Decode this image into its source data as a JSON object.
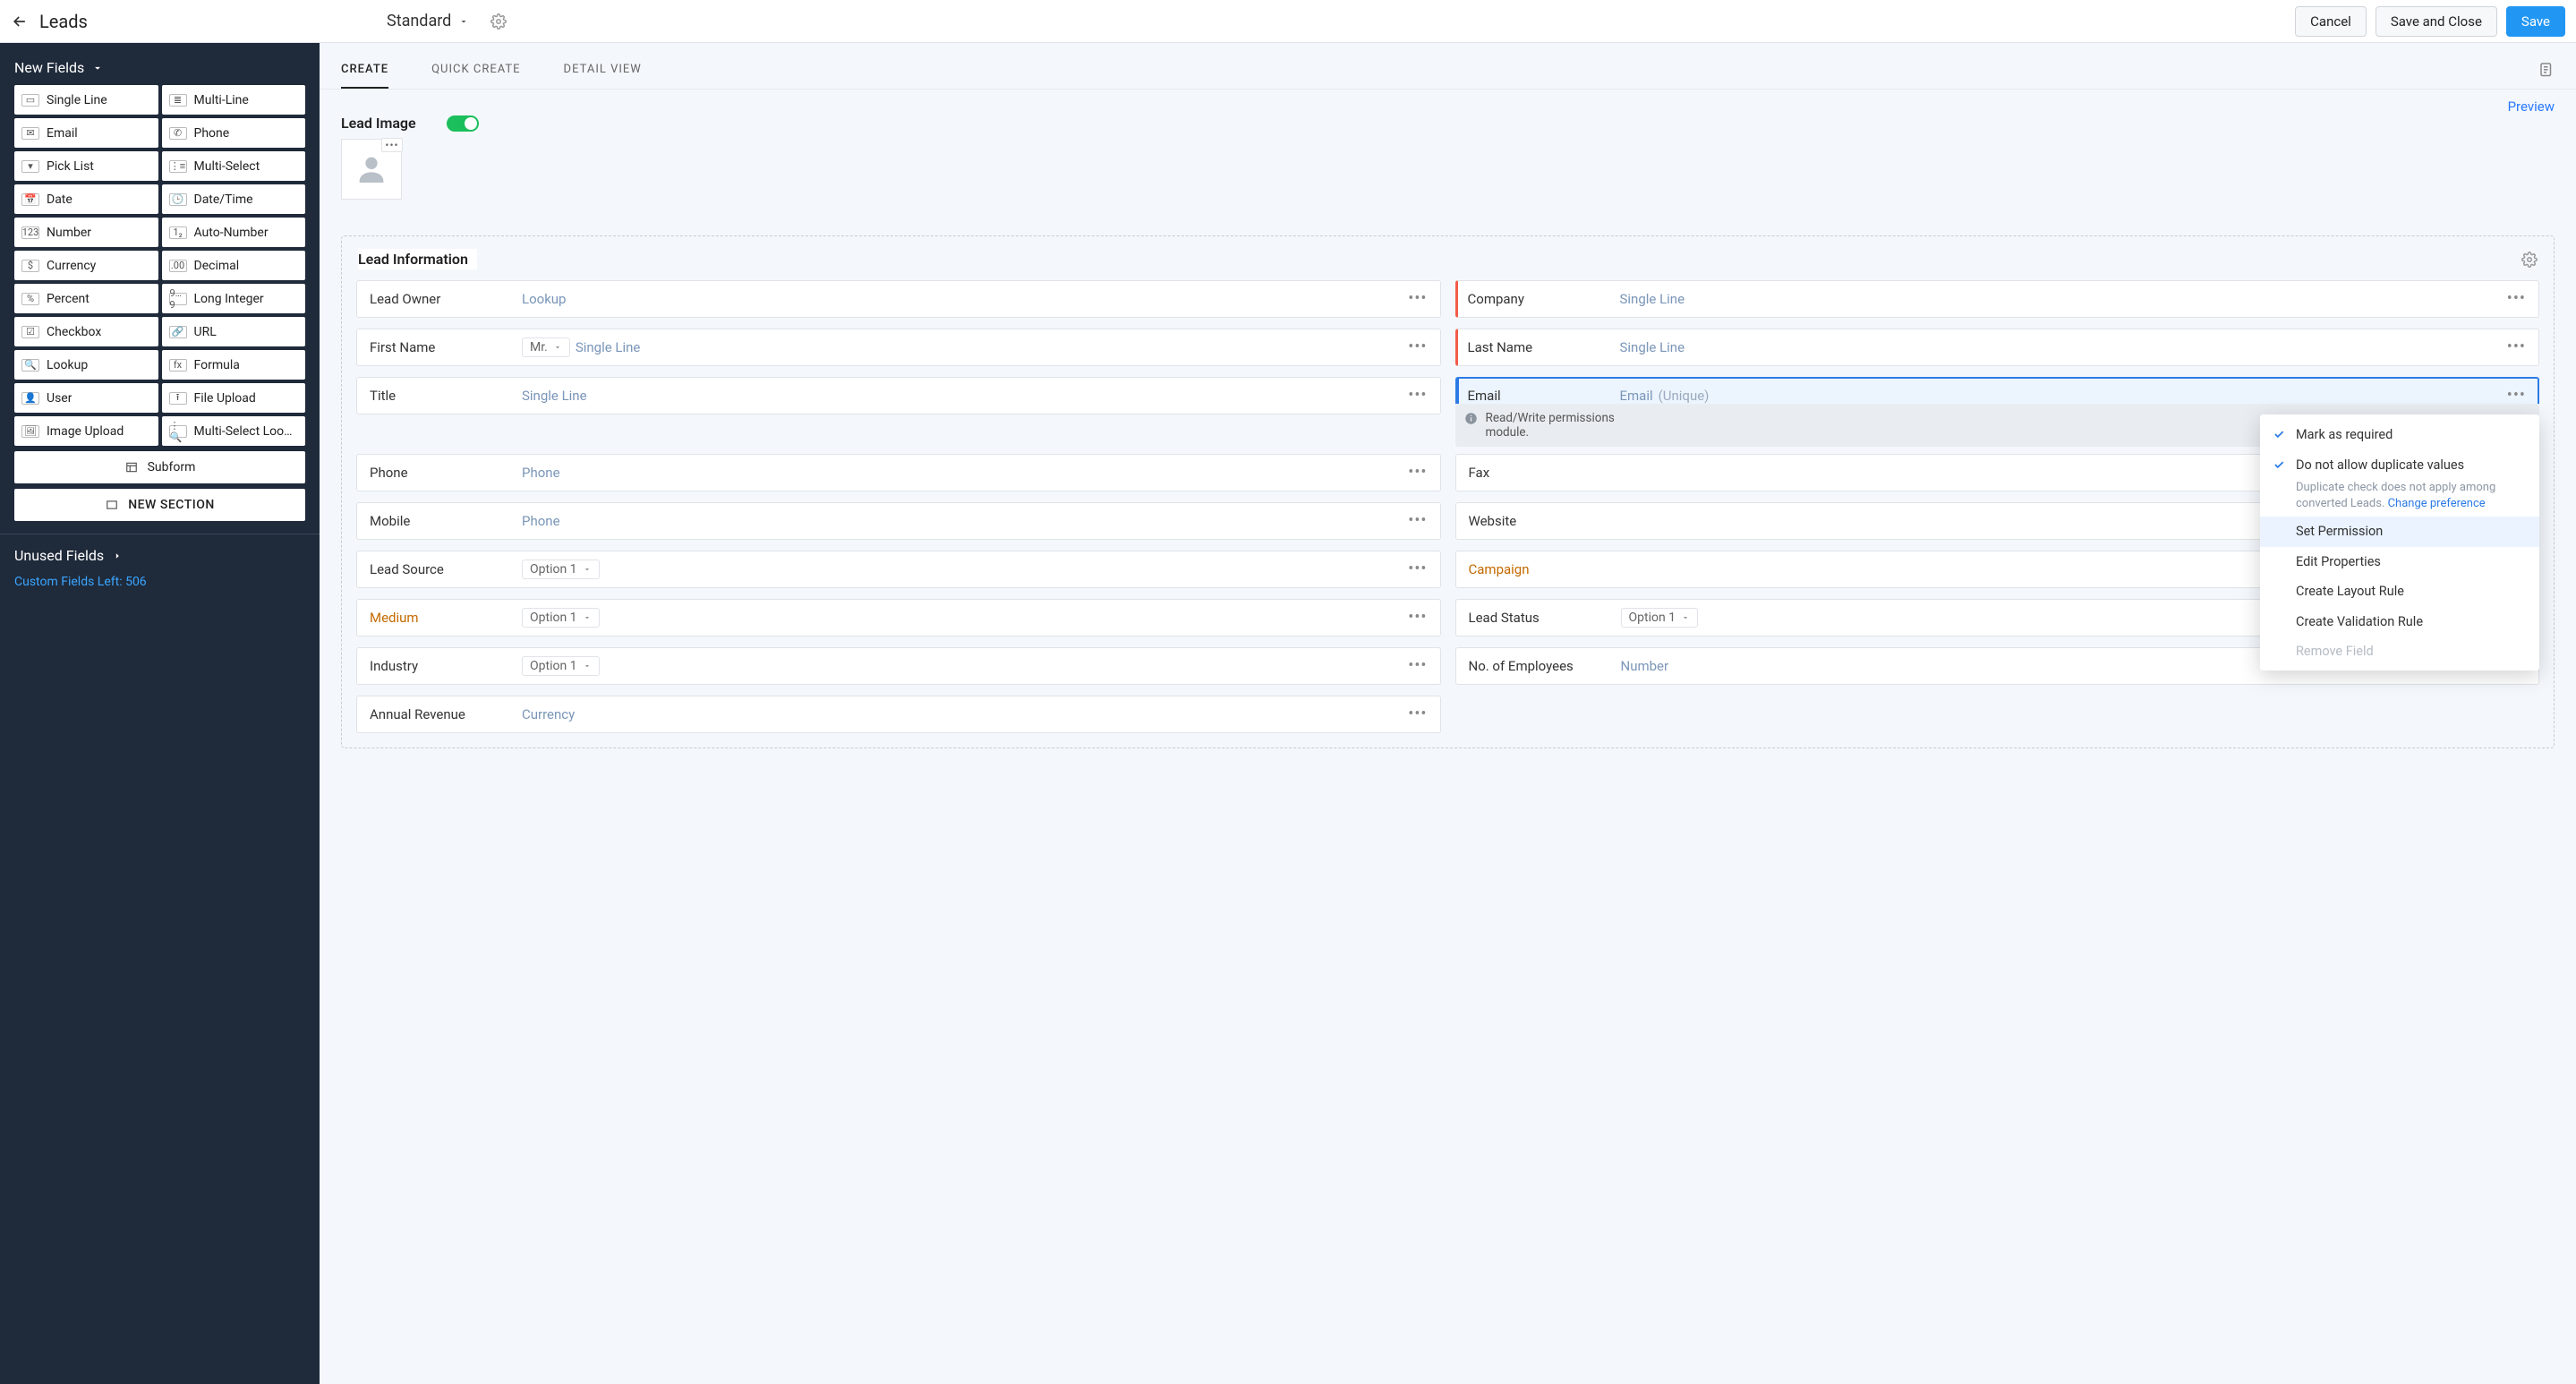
{
  "header": {
    "title": "Leads",
    "layout_name": "Standard",
    "cancel": "Cancel",
    "save_close": "Save and Close",
    "save": "Save"
  },
  "sidebar": {
    "new_fields": "New Fields",
    "fields": [
      {
        "label": "Single Line",
        "ico": "▭"
      },
      {
        "label": "Multi-Line",
        "ico": "≣"
      },
      {
        "label": "Email",
        "ico": "✉"
      },
      {
        "label": "Phone",
        "ico": "✆"
      },
      {
        "label": "Pick List",
        "ico": "▾"
      },
      {
        "label": "Multi-Select",
        "ico": "⋮≡"
      },
      {
        "label": "Date",
        "ico": "📅"
      },
      {
        "label": "Date/Time",
        "ico": "🕒"
      },
      {
        "label": "Number",
        "ico": "123"
      },
      {
        "label": "Auto-Number",
        "ico": "1₂"
      },
      {
        "label": "Currency",
        "ico": "$"
      },
      {
        "label": "Decimal",
        "ico": ".00"
      },
      {
        "label": "Percent",
        "ico": "%"
      },
      {
        "label": "Long Integer",
        "ico": "9…9"
      },
      {
        "label": "Checkbox",
        "ico": "☑"
      },
      {
        "label": "URL",
        "ico": "🔗"
      },
      {
        "label": "Lookup",
        "ico": "🔍"
      },
      {
        "label": "Formula",
        "ico": "fx"
      },
      {
        "label": "User",
        "ico": "👤"
      },
      {
        "label": "File Upload",
        "ico": "⭱"
      },
      {
        "label": "Image Upload",
        "ico": "🖼"
      },
      {
        "label": "Multi-Select Look…",
        "ico": "⋮🔍"
      }
    ],
    "subform": "Subform",
    "new_section": "NEW SECTION",
    "unused": "Unused Fields",
    "custom_left": "Custom Fields Left: 506"
  },
  "tabs": {
    "create": "CREATE",
    "quick": "QUICK CREATE",
    "detail": "DETAIL VIEW"
  },
  "preview": "Preview",
  "lead_image": "Lead Image",
  "section": {
    "title": "Lead Information"
  },
  "left_fields": [
    {
      "name": "Lead Owner",
      "type": "Lookup"
    },
    {
      "name": "First Name",
      "type": "Single Line",
      "prefix": "Mr."
    },
    {
      "name": "Title",
      "type": "Single Line"
    },
    {
      "name": "Phone",
      "type": "Phone"
    },
    {
      "name": "Mobile",
      "type": "Phone"
    },
    {
      "name": "Lead Source",
      "type": "Option 1",
      "pill": true
    },
    {
      "name": "Medium",
      "type": "Option 1",
      "pill": true,
      "warm": true
    },
    {
      "name": "Industry",
      "type": "Option 1",
      "pill": true
    },
    {
      "name": "Annual Revenue",
      "type": "Currency"
    }
  ],
  "right_fields": [
    {
      "name": "Company",
      "type": "Single Line",
      "required": true
    },
    {
      "name": "Last Name",
      "type": "Single Line",
      "required": true
    },
    {
      "name": "Email",
      "type": "Email",
      "suffix": "(Unique)",
      "required": true,
      "selected": true,
      "menu": true
    },
    {
      "name": "Fax"
    },
    {
      "name": "Website"
    },
    {
      "name": "Campaign",
      "warm": true
    },
    {
      "name": "Lead Status",
      "type": "Option 1",
      "pill": true
    },
    {
      "name": "No. of Employees",
      "type": "Number"
    }
  ],
  "perm_note": {
    "line1": "Read/Write permissions",
    "line2": "module."
  },
  "menu": {
    "mark_required": "Mark as required",
    "no_dup": "Do not allow duplicate values",
    "dup_sub": "Duplicate check does not apply among converted Leads. ",
    "dup_link": "Change preference",
    "set_perm": "Set Permission",
    "edit_prop": "Edit Properties",
    "layout_rule": "Create Layout Rule",
    "valid_rule": "Create Validation Rule",
    "remove": "Remove Field"
  }
}
